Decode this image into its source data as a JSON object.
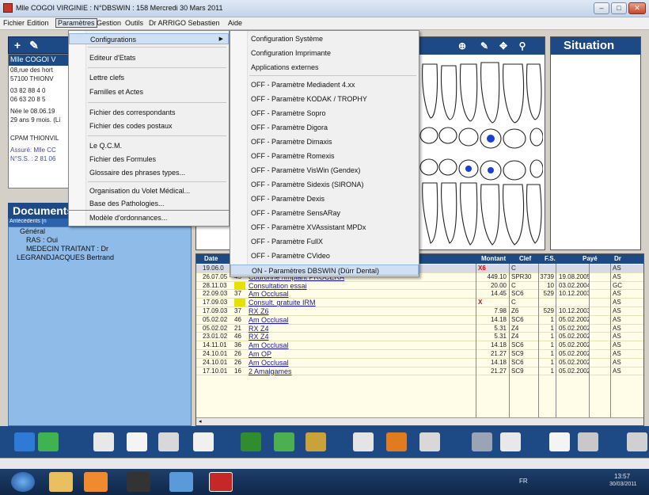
{
  "window": {
    "title": "Mlle COGOI VIRGINIE : N°DBSWIN : 158 Mercredi 30 Mars 2011"
  },
  "menubar": {
    "items": [
      "Fichier",
      "Edition",
      "Paramètres",
      "Gestion",
      "Outils",
      "Dr ARRIGO Sebastien",
      "Aide"
    ]
  },
  "patient": {
    "name": "Mlle COGOI V",
    "lines": [
      "08,rue des hort",
      "57100 THIONV",
      "03 82 88 4 0",
      "06 63 20 8 5",
      "Née le 08.06.19",
      "29 ans 9 mois. (Li",
      "",
      "CPAM THIONVIL",
      "Assuré: Mlle CC",
      "N°S.S. : 2 81 06"
    ]
  },
  "documents": {
    "title": "Documents",
    "subtitle": "Antécédents [n",
    "lines": [
      "Général",
      "RAS : Oui",
      "MEDECIN TRAITANT : Dr",
      "LEGRANDJACQUES Bertrand"
    ]
  },
  "situation": {
    "title": "Situation"
  },
  "menu_parametres": {
    "items": [
      "Configurations",
      "Editeur d'Etats",
      "Lettre clefs",
      "Familles et Actes",
      "Fichier des correspondants",
      "Fichier des codes postaux",
      "Le Q.C.M.",
      "Fichier des Formules",
      "Glossaire des phrases types...",
      "Organisation du Volet Médical...",
      "Base des Pathologies...",
      "Modèle d'ordonnances..."
    ]
  },
  "submenu_configurations": {
    "items": [
      "Configuration Système",
      "Configuration Imprimante",
      "Applications externes",
      "OFF - Paramètre Mediadent 4.xx",
      "OFF - Paramètre KODAK / TROPHY",
      "OFF - Paramètre Sopro",
      "OFF - Paramètre Digora",
      "OFF - Paramètre Dimaxis",
      "OFF - Paramètre Romexis",
      "OFF - Paramètre VisWin (Gendex)",
      "OFF - Paramètre Sidexis (SIRONA)",
      "OFF - Paramètre Dexis",
      "OFF - Paramètre SensARay",
      "OFF - Paramètre XVAssistant MPDx",
      "OFF - Paramètre FullX",
      "OFF - Paramètre CVideo",
      "ON - Paramètres DBSWIN (Dürr Dental)"
    ]
  },
  "grid": {
    "headers": [
      "Date",
      "Montant",
      "Clef",
      "F.S.",
      "Payé",
      "Dr"
    ],
    "rows": [
      {
        "date": "19.06.0",
        "tooth": "",
        "desc": "",
        "montant": "",
        "mark": "X6",
        "clef": "C",
        "fs": "",
        "paye": "",
        "dr": "AS"
      },
      {
        "date": "26.07.05",
        "tooth": "45",
        "desc": "Couronne /Implant PROCERA",
        "montant": "449.10",
        "mark": "",
        "clef": "SPR30",
        "fs": "3739",
        "paye": "19.08.2005",
        "dr": "AS"
      },
      {
        "date": "28.11.03",
        "tooth": "",
        "desc": "Consultation essai",
        "montant": "20.00",
        "mark": "",
        "clef": "C",
        "fs": "10",
        "paye": "03.02.2004",
        "dr": "GC"
      },
      {
        "date": "22.09.03",
        "tooth": "37",
        "desc": "Am Occlusal",
        "montant": "14.45",
        "mark": "",
        "clef": "SC6",
        "fs": "529",
        "paye": "10.12.2003",
        "dr": "AS"
      },
      {
        "date": "17.09.03",
        "tooth": "",
        "desc": "Consult. gratuite IRM",
        "montant": "",
        "mark": "X",
        "clef": "C",
        "fs": "",
        "paye": "",
        "dr": "AS"
      },
      {
        "date": "17.09.03",
        "tooth": "37",
        "desc": "RX Z6",
        "montant": "7.98",
        "mark": "",
        "clef": "Z6",
        "fs": "529",
        "paye": "10.12.2003",
        "dr": "AS"
      },
      {
        "date": "05.02.02",
        "tooth": "46",
        "desc": "Am Occlusal",
        "montant": "14.18",
        "mark": "",
        "clef": "SC6",
        "fs": "1",
        "paye": "05.02.2002",
        "dr": "AS"
      },
      {
        "date": "05.02.02",
        "tooth": "21",
        "desc": "RX Z4",
        "montant": "5.31",
        "mark": "",
        "clef": "Z4",
        "fs": "1",
        "paye": "05.02.2002",
        "dr": "AS"
      },
      {
        "date": "23.01.02",
        "tooth": "46",
        "desc": "RX Z4",
        "montant": "5.31",
        "mark": "",
        "clef": "Z4",
        "fs": "1",
        "paye": "05.02.2002",
        "dr": "AS"
      },
      {
        "date": "14.11.01",
        "tooth": "36",
        "desc": "Am Occlusal",
        "montant": "14.18",
        "mark": "",
        "clef": "SC6",
        "fs": "1",
        "paye": "05.02.2002",
        "dr": "AS"
      },
      {
        "date": "24.10.01",
        "tooth": "26",
        "desc": "Am OP",
        "montant": "21.27",
        "mark": "",
        "clef": "SC9",
        "fs": "1",
        "paye": "05.02.2002",
        "dr": "AS"
      },
      {
        "date": "24.10.01",
        "tooth": "26",
        "desc": "Am Occlusal",
        "montant": "14.18",
        "mark": "",
        "clef": "SC6",
        "fs": "1",
        "paye": "05.02.2002",
        "dr": "AS"
      },
      {
        "date": "17.10.01",
        "tooth": "16",
        "desc": "2 Amalgames",
        "montant": "21.27",
        "mark": "",
        "clef": "SC9",
        "fs": "1",
        "paye": "05.02.2002",
        "dr": "AS"
      }
    ]
  },
  "taskbar": {
    "lang": "FR",
    "time": "13:57",
    "date": "30/03/2011"
  },
  "colors": {
    "panel_blue": "#1d4a85",
    "doc_blue": "#8ebbe8",
    "grid_bg": "#fffde8",
    "filling": "#1a3fd6"
  }
}
